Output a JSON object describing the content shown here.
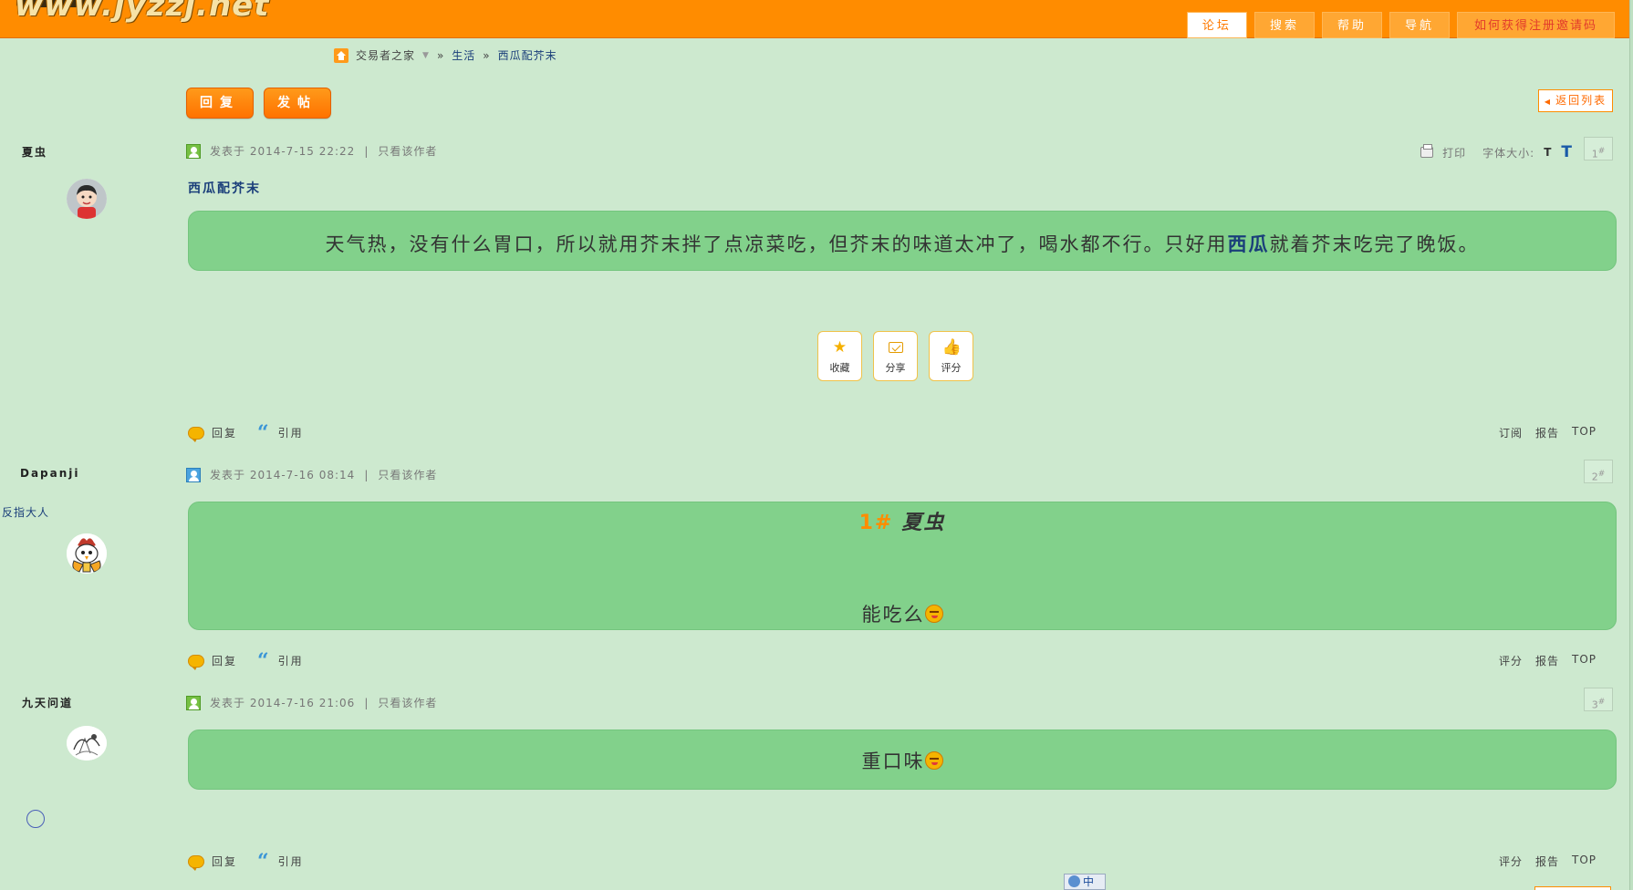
{
  "site": {
    "logo_text": "www.jyzzj.net"
  },
  "nav": {
    "items": [
      "论坛",
      "搜索",
      "帮助",
      "导航",
      "如何获得注册邀请码"
    ]
  },
  "breadcrumb": {
    "home": "交易者之家",
    "sep": "»",
    "forum": "生活",
    "thread": "西瓜配芥末"
  },
  "toolbar": {
    "reply_label": "回复",
    "post_label": "发帖",
    "back_label": "返回列表"
  },
  "thread": {
    "title": "西瓜配芥末",
    "print_label": "打印",
    "font_size_label": "字体大小:",
    "font_small": "T",
    "font_big": "T"
  },
  "actions": {
    "favorite": "收藏",
    "share": "分享",
    "rate": "评分"
  },
  "posts": [
    {
      "author": "夏虫",
      "meta": "发表于 2014-7-15 22:22",
      "sep": "|",
      "only_author": "只看该作者",
      "floor": "1",
      "floor_mark": "#",
      "content_before": "天气热，没有什么胃口，所以就用芥末拌了点凉菜吃，但芥末的味道太冲了，喝水都不行。只好用",
      "content_link": "西瓜",
      "content_after": "就着芥末吃完了晚饭。",
      "foot_reply": "回复",
      "foot_quote": "引用",
      "foot_right": [
        "订阅",
        "报告",
        "TOP"
      ]
    },
    {
      "author": "Dapanji",
      "user_title": "反指大人",
      "meta": "发表于 2014-7-16 08:14",
      "sep": "|",
      "only_author": "只看该作者",
      "floor": "2",
      "floor_mark": "#",
      "quote_floor": "1#",
      "quote_author": "夏虫",
      "content": "能吃么",
      "foot_reply": "回复",
      "foot_quote": "引用",
      "foot_right": [
        "评分",
        "报告",
        "TOP"
      ]
    },
    {
      "author": "九天问道",
      "meta": "发表于 2014-7-16 21:06",
      "sep": "|",
      "only_author": "只看该作者",
      "floor": "3",
      "floor_mark": "#",
      "content": "重口味",
      "foot_reply": "回复",
      "foot_quote": "引用",
      "foot_right": [
        "评分",
        "报告",
        "TOP"
      ]
    }
  ],
  "ime": {
    "label": "中"
  },
  "colors": {
    "page_bg": "#cde9cf",
    "header_orange": "#ff8c00",
    "content_green": "#82d18b",
    "link_blue": "#1a3e7a"
  }
}
